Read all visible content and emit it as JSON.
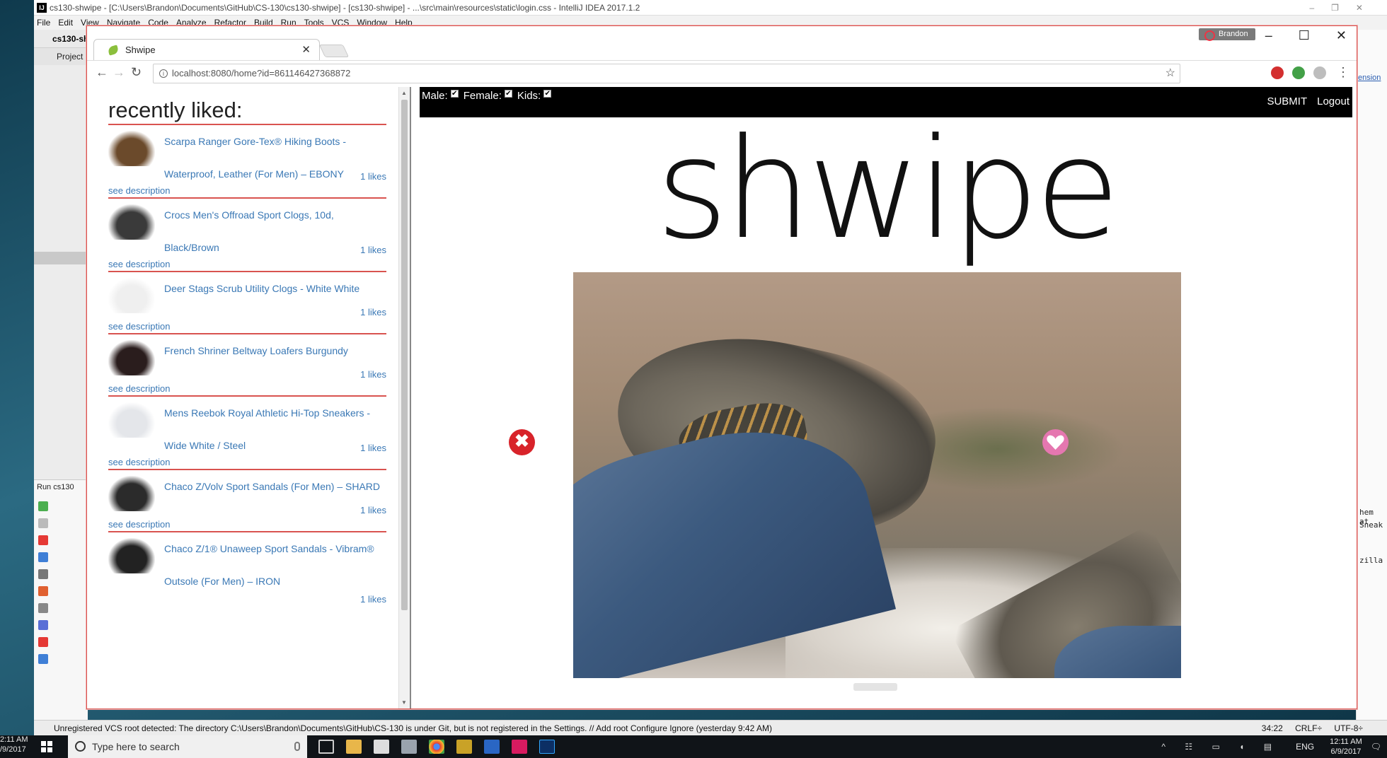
{
  "ide": {
    "title": "cs130-shwipe - [C:\\Users\\Brandon\\Documents\\GitHub\\CS-130\\cs130-shwipe] - [cs130-shwipe] - ...\\src\\main\\resources\\static\\login.css - IntelliJ IDEA 2017.1.2",
    "menu": [
      "File",
      "Edit",
      "View",
      "Navigate",
      "Code",
      "Analyze",
      "Refactor",
      "Build",
      "Run",
      "Tools",
      "VCS",
      "Window",
      "Help"
    ],
    "project_name": "cs130-sh",
    "project_tab": "Project",
    "run_label": "Run",
    "run_config": "cs130",
    "right_link": "ension",
    "right_snips": [
      "hem at",
      "Sneak",
      "zilla"
    ],
    "status_message": "Unregistered VCS root detected: The directory C:\\Users\\Brandon\\Documents\\GitHub\\CS-130 is under Git, but is not registered in the Settings. // Add root  Configure  Ignore (yesterday 9:42 AM)",
    "status_right": [
      "34:22",
      "CRLF÷",
      "UTF-8÷"
    ]
  },
  "taskbar": {
    "left_time": "2:11 AM",
    "left_date": "/9/2017",
    "search_placeholder": "Type here to search",
    "lang": "ENG",
    "time": "12:11 AM",
    "date": "6/9/2017"
  },
  "chrome": {
    "tab_title": "Shwipe",
    "user": "Brandon",
    "url": "localhost:8080/home?id=861146427368872"
  },
  "sidebar": {
    "title": "recently liked:",
    "items": [
      {
        "name": "Scarpa Ranger Gore-Tex® Hiking Boots - Waterproof, Leather (For Men) – EBONY",
        "likes": "1 likes",
        "desc": "see description",
        "color": "#6b4a2b"
      },
      {
        "name": "Crocs Men's Offroad Sport Clogs, 10d, Black/Brown",
        "likes": "1 likes",
        "desc": "see description",
        "color": "#3a3a3a"
      },
      {
        "name": "Deer Stags Scrub Utility Clogs - White White",
        "likes": "1 likes",
        "desc": "see description",
        "color": "#efefef"
      },
      {
        "name": "French Shriner Beltway Loafers Burgundy",
        "likes": "1 likes",
        "desc": "see description",
        "color": "#2a1d1d"
      },
      {
        "name": "Mens Reebok Royal Athletic Hi-Top Sneakers - Wide White / Steel",
        "likes": "1 likes",
        "desc": "see description",
        "color": "#e4e6ea"
      },
      {
        "name": "Chaco Z/Volv Sport Sandals (For Men) – SHARD",
        "likes": "1 likes",
        "desc": "see description",
        "color": "#2b2b2b"
      },
      {
        "name": "Chaco Z/1® Unaweep Sport Sandals - Vibram® Outsole (For Men) – IRON",
        "likes": "1 likes",
        "desc": "",
        "color": "#222222"
      }
    ]
  },
  "filters": {
    "male_label": "Male:",
    "female_label": "Female:",
    "kids_label": "Kids:",
    "male_checked": true,
    "female_checked": true,
    "kids_checked": true
  },
  "nav": {
    "submit": "SUBMIT",
    "logout": "Logout"
  },
  "logo": "shwipe",
  "buttons": {
    "reject": "✖",
    "like_icon": "heart-icon",
    "reject_icon": "close-icon"
  },
  "colors": {
    "accent_red": "#d9534f",
    "link_blue": "#3a78b5",
    "like_pink": "#e577b0",
    "reject_red": "#d8232a"
  }
}
